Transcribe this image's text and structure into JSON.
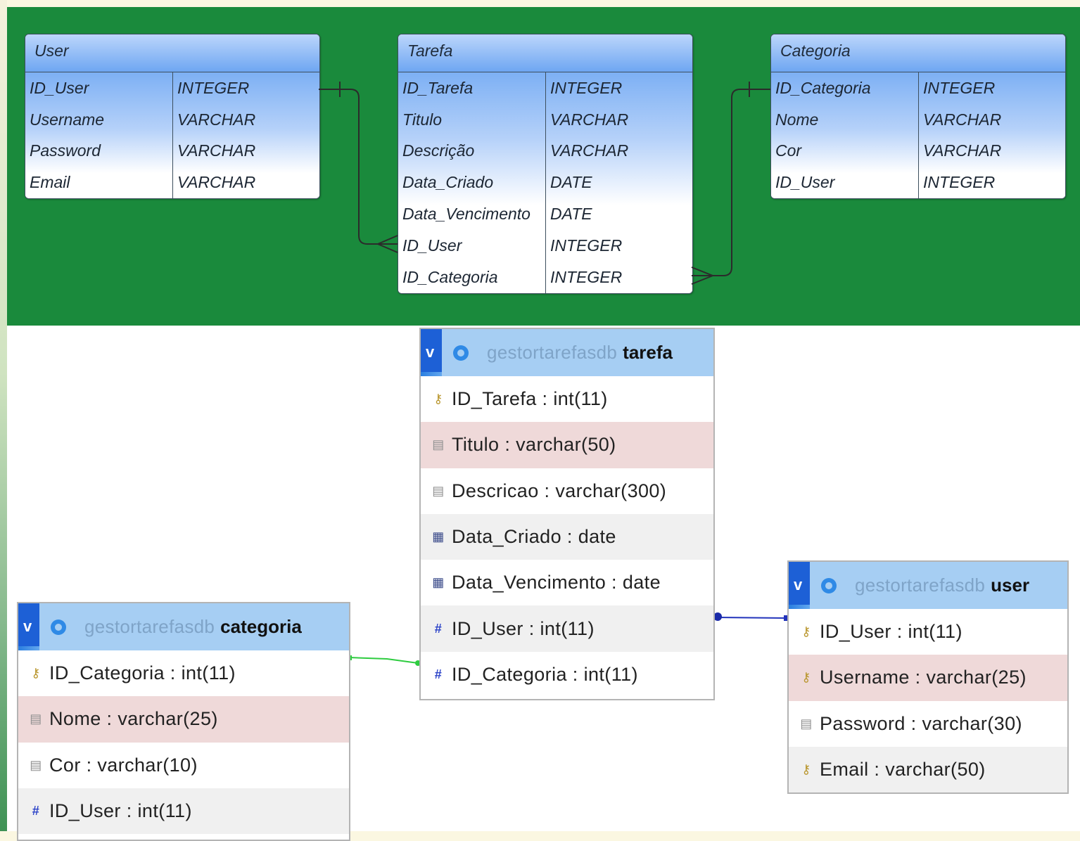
{
  "er_model": {
    "entities": [
      {
        "name": "User",
        "attributes": [
          {
            "field": "ID_User",
            "type": "INTEGER"
          },
          {
            "field": "Username",
            "type": "VARCHAR"
          },
          {
            "field": "Password",
            "type": "VARCHAR"
          },
          {
            "field": "Email",
            "type": "VARCHAR"
          }
        ]
      },
      {
        "name": "Tarefa",
        "attributes": [
          {
            "field": "ID_Tarefa",
            "type": "INTEGER"
          },
          {
            "field": "Titulo",
            "type": "VARCHAR"
          },
          {
            "field": "Descrição",
            "type": "VARCHAR"
          },
          {
            "field": "Data_Criado",
            "type": "DATE"
          },
          {
            "field": "Data_Vencimento",
            "type": "DATE"
          },
          {
            "field": "ID_User",
            "type": "INTEGER"
          },
          {
            "field": "ID_Categoria",
            "type": "INTEGER"
          }
        ]
      },
      {
        "name": "Categoria",
        "attributes": [
          {
            "field": "ID_Categoria",
            "type": "INTEGER"
          },
          {
            "field": "Nome",
            "type": "VARCHAR"
          },
          {
            "field": "Cor",
            "type": "VARCHAR"
          },
          {
            "field": "ID_User",
            "type": "INTEGER"
          }
        ]
      }
    ],
    "relationships": [
      {
        "from": "User.ID_User",
        "to": "Tarefa.ID_User",
        "cardinality": "one-to-many"
      },
      {
        "from": "Categoria.ID_Categoria",
        "to": "Tarefa.ID_Categoria",
        "cardinality": "one-to-many"
      }
    ]
  },
  "db_designer": {
    "database": "gestortarefasdb",
    "toggle_label": "v",
    "tables": [
      {
        "name": "tarefa",
        "columns": [
          {
            "label": "ID_Tarefa : int(11)",
            "icon": "primary-key-icon"
          },
          {
            "label": "Titulo : varchar(50)",
            "icon": "text-column-icon"
          },
          {
            "label": "Descricao : varchar(300)",
            "icon": "text-column-icon"
          },
          {
            "label": "Data_Criado : date",
            "icon": "date-column-icon"
          },
          {
            "label": "Data_Vencimento : date",
            "icon": "date-column-icon"
          },
          {
            "label": "ID_User : int(11)",
            "icon": "number-column-icon"
          },
          {
            "label": "ID_Categoria : int(11)",
            "icon": "number-column-icon"
          }
        ]
      },
      {
        "name": "categoria",
        "columns": [
          {
            "label": "ID_Categoria : int(11)",
            "icon": "primary-key-icon"
          },
          {
            "label": "Nome : varchar(25)",
            "icon": "text-column-icon"
          },
          {
            "label": "Cor : varchar(10)",
            "icon": "text-column-icon"
          },
          {
            "label": "ID_User : int(11)",
            "icon": "number-column-icon"
          }
        ]
      },
      {
        "name": "user",
        "columns": [
          {
            "label": "ID_User : int(11)",
            "icon": "primary-key-icon"
          },
          {
            "label": "Username : varchar(25)",
            "icon": "unique-key-icon"
          },
          {
            "label": "Password : varchar(30)",
            "icon": "text-column-icon"
          },
          {
            "label": "Email : varchar(50)",
            "icon": "unique-key-icon"
          }
        ]
      }
    ],
    "relations": [
      {
        "from": "categoria",
        "to": "tarefa",
        "color": "#2ecc40"
      },
      {
        "from": "user",
        "to": "tarefa",
        "color": "#2233bb"
      }
    ]
  },
  "colors": {
    "green_panel": "#1a8a3c",
    "entity_header": "#6ea6f2",
    "pma_header": "#a6cef3",
    "row_highlight": "#efd9d9"
  }
}
